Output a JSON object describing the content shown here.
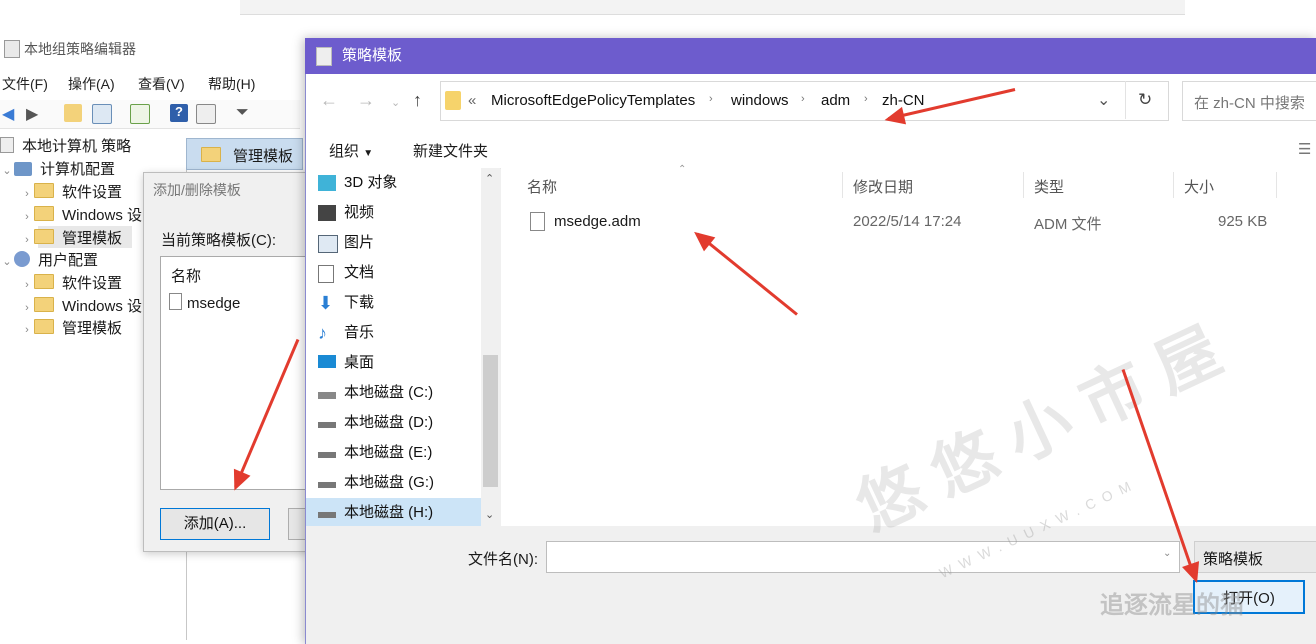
{
  "background_app": {
    "title": "本地组策略编辑器",
    "menu": [
      "文件(F)",
      "操作(A)",
      "查看(V)",
      "帮助(H)"
    ],
    "tree": {
      "root": "本地计算机 策略",
      "computer": "计算机配置",
      "computer_children": [
        "软件设置",
        "Windows 设",
        "管理模板"
      ],
      "user": "用户配置",
      "user_children": [
        "软件设置",
        "Windows 设",
        "管理模板"
      ]
    },
    "pane_header": "管理模板"
  },
  "add_remove_dialog": {
    "title": "添加/删除模板",
    "current_label": "当前策略模板(C):",
    "list_header": "名称",
    "items": [
      "msedge"
    ],
    "add_button": "添加(A)..."
  },
  "dialog": {
    "title": "策略模板",
    "breadcrumb": [
      "«",
      "MicrosoftEdgePolicyTemplates",
      "windows",
      "adm",
      "zh-CN"
    ],
    "search_placeholder": "在 zh-CN 中搜索",
    "toolbar": {
      "organize": "组织",
      "new_folder": "新建文件夹"
    },
    "nav_items": [
      {
        "label": "3D 对象",
        "icon": "3d-objects-icon"
      },
      {
        "label": "视频",
        "icon": "video-icon"
      },
      {
        "label": "图片",
        "icon": "pictures-icon"
      },
      {
        "label": "文档",
        "icon": "document-icon"
      },
      {
        "label": "下载",
        "icon": "download-icon"
      },
      {
        "label": "音乐",
        "icon": "music-icon"
      },
      {
        "label": "桌面",
        "icon": "desktop-icon"
      },
      {
        "label": "本地磁盘 (C:)",
        "icon": "windows-drive-icon"
      },
      {
        "label": "本地磁盘 (D:)",
        "icon": "drive-icon"
      },
      {
        "label": "本地磁盘 (E:)",
        "icon": "drive-icon"
      },
      {
        "label": "本地磁盘 (G:)",
        "icon": "drive-icon"
      },
      {
        "label": "本地磁盘 (H:)",
        "icon": "drive-icon"
      }
    ],
    "columns": [
      "名称",
      "修改日期",
      "类型",
      "大小"
    ],
    "files": [
      {
        "name": "msedge.adm",
        "modified": "2022/5/14 17:24",
        "type": "ADM 文件",
        "size": "925 KB"
      }
    ],
    "filename_label": "文件名(N):",
    "filename_value": "",
    "filetype_value": "策略模板",
    "open_button": "打开(O)"
  },
  "watermark": {
    "text": "悠悠小市屋",
    "site": "WWW.UUXW.COM",
    "brand": "追逐流星的猫"
  },
  "colors": {
    "titlebar": "#6d5ccd",
    "arrow": "#e23b2e",
    "accent": "#0078d7",
    "selection": "#cce4f7"
  }
}
